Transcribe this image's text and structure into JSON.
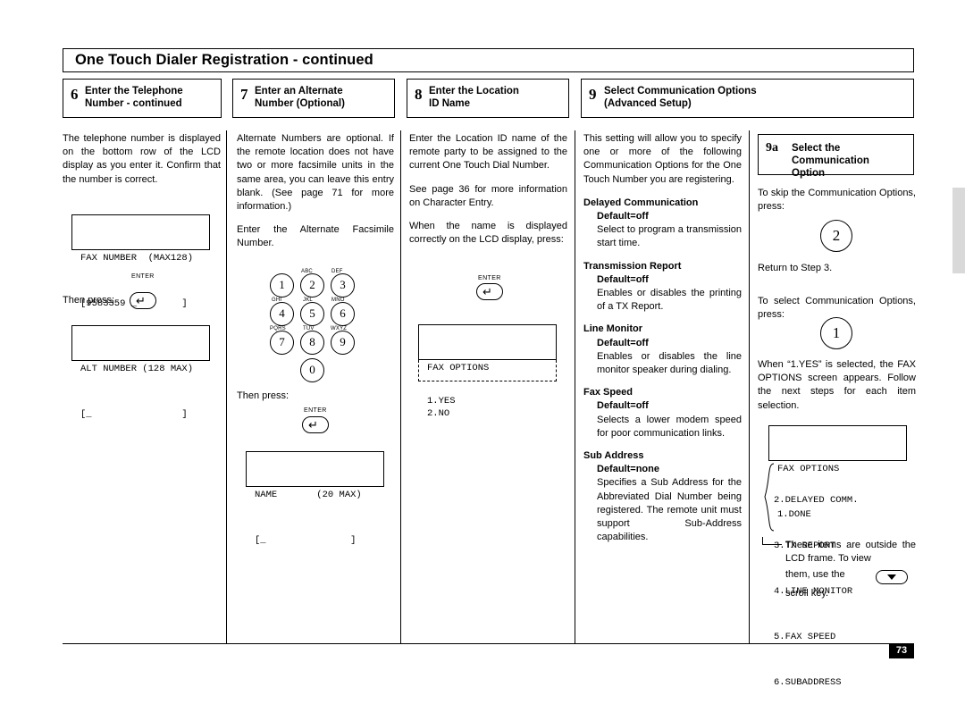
{
  "page": {
    "title": "One Touch Dialer Registration - continued",
    "number": "73"
  },
  "steps": [
    {
      "num": "6",
      "label": "Enter the Telephone\nNumber - continued"
    },
    {
      "num": "7",
      "label": "Enter an Alternate\nNumber (Optional)"
    },
    {
      "num": "8",
      "label": "Enter the Location\nID Name"
    },
    {
      "num": "9",
      "label": "Select Communication Options\n(Advanced Setup)"
    }
  ],
  "col1": {
    "para1": "The telephone number is displayed on the bottom row of the LCD display as you enter it. Confirm that the number is correct.",
    "lcd1_line1": "FAX NUMBER  (MAX128)",
    "lcd1_line2": "[9583359 _        ]",
    "then_press": "Then press:",
    "enter_label": "ENTER",
    "lcd2_line1": "ALT NUMBER (128 MAX)",
    "lcd2_line2": "[_                ]"
  },
  "col2": {
    "para1": "Alternate Numbers are optional. If the remote location does not have two or more facsimile units in the same area, you can leave this entry blank. (See page 71 for more information.)",
    "para2": "Enter the Alternate Facsimile Number.",
    "keys": [
      {
        "digit": "1",
        "sub": ""
      },
      {
        "digit": "2",
        "sub": "ABC"
      },
      {
        "digit": "3",
        "sub": "DEF"
      },
      {
        "digit": "4",
        "sub": "GHI"
      },
      {
        "digit": "5",
        "sub": "JKL"
      },
      {
        "digit": "6",
        "sub": "MNO"
      },
      {
        "digit": "7",
        "sub": "PQRS"
      },
      {
        "digit": "8",
        "sub": "TUV"
      },
      {
        "digit": "9",
        "sub": "WXYZ"
      },
      {
        "digit": "0",
        "sub": ""
      }
    ],
    "then_press": "Then press:",
    "enter_label": "ENTER",
    "lcd_line1": "NAME       (20 MAX)",
    "lcd_line2": "[_               ]"
  },
  "col3": {
    "para1": "Enter the Location ID name of the remote party to be assigned to the current One Touch Dial Number.",
    "para2": "See page 36 for more information on Character Entry.",
    "para3": "When the name is displayed correctly on the LCD display, press:",
    "enter_label": "ENTER",
    "lcd_line1": "FAX OPTIONS",
    "lcd_line2": "2.NO",
    "lcd_dashed": "1.YES"
  },
  "col4": {
    "intro": "This setting will allow you to specify one or more of the following Communication Options for the One Touch Number you are registering.",
    "items": [
      {
        "head": "Delayed Communication",
        "default": "Default=off",
        "desc": "Select to program a transmission start time."
      },
      {
        "head": "Transmission Report",
        "default": "Default=off",
        "desc": "Enables or disables the printing of a TX Report."
      },
      {
        "head": "Line Monitor",
        "default": "Default=off",
        "desc": "Enables or disables the line monitor speaker during dialing."
      },
      {
        "head": "Fax Speed",
        "default": "Default=off",
        "desc": "Selects a lower modem speed for poor communication links."
      },
      {
        "head": "Sub Address",
        "default": "Default=none",
        "desc": "Specifies a Sub Address for the Abbreviated Dial Number being registered. The remote unit must support Sub-Address capabilities."
      }
    ]
  },
  "col5": {
    "box_num": "9a",
    "box_label": "Select the\nCommunication\nOption",
    "skip_text": "To skip the Communication Options, press:",
    "circle_skip": "2",
    "return_text": "Return to Step 3.",
    "select_text": "To select Communication Options, press:",
    "circle_select": "1",
    "yes_text": "When “1.YES” is selected, the FAX OPTIONS screen appears. Follow the next steps for each item selection.",
    "lcd_line1": "FAX OPTIONS",
    "lcd_line2": "1.DONE",
    "list": [
      "2.DELAYED COMM.",
      "3.TX REPORT",
      "4.LINE MONITOR",
      "5.FAX SPEED",
      "6.SUBADDRESS"
    ],
    "note": "These items are outside the LCD frame. To view",
    "note2a": "them,  use  the",
    "note2b": "scroll key."
  }
}
